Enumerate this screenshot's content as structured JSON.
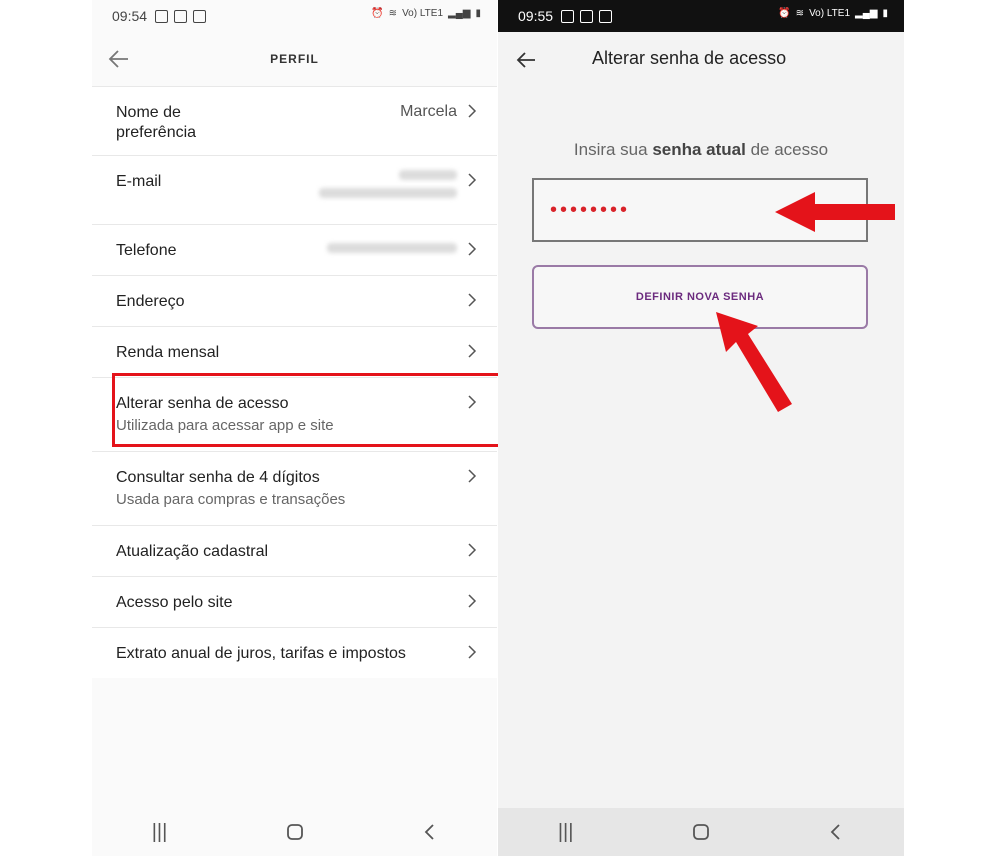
{
  "left": {
    "status_time": "09:54",
    "status_network": "Vo) LTE1",
    "header_title": "PERFIL",
    "rows": [
      {
        "label": "Nome de preferência",
        "value": "Marcela",
        "sub": ""
      },
      {
        "label": "E-mail",
        "value": "",
        "sub": ""
      },
      {
        "label": "Telefone",
        "value": "",
        "sub": ""
      },
      {
        "label": "Endereço",
        "value": "",
        "sub": ""
      },
      {
        "label": "Renda mensal",
        "value": "",
        "sub": ""
      },
      {
        "label": "Alterar senha de acesso",
        "value": "",
        "sub": "Utilizada para acessar app e site"
      },
      {
        "label": "Consultar senha de 4 dígitos",
        "value": "",
        "sub": "Usada para compras e transações"
      },
      {
        "label": "Atualização cadastral",
        "value": "",
        "sub": ""
      },
      {
        "label": "Acesso pelo site",
        "value": "",
        "sub": ""
      },
      {
        "label": "Extrato anual de juros, tarifas e impostos",
        "value": "",
        "sub": ""
      }
    ]
  },
  "right": {
    "status_time": "09:55",
    "status_network": "Vo) LTE1",
    "title": "Alterar senha de acesso",
    "prompt_pre": "Insira sua ",
    "prompt_bold": "senha atual",
    "prompt_post": " de acesso",
    "password_mask": "••••••••",
    "button_label": "DEFINIR NOVA SENHA"
  },
  "colors": {
    "highlight": "#e4131a",
    "arrow": "#e4131a",
    "accent_purple": "#6b2a7e"
  }
}
